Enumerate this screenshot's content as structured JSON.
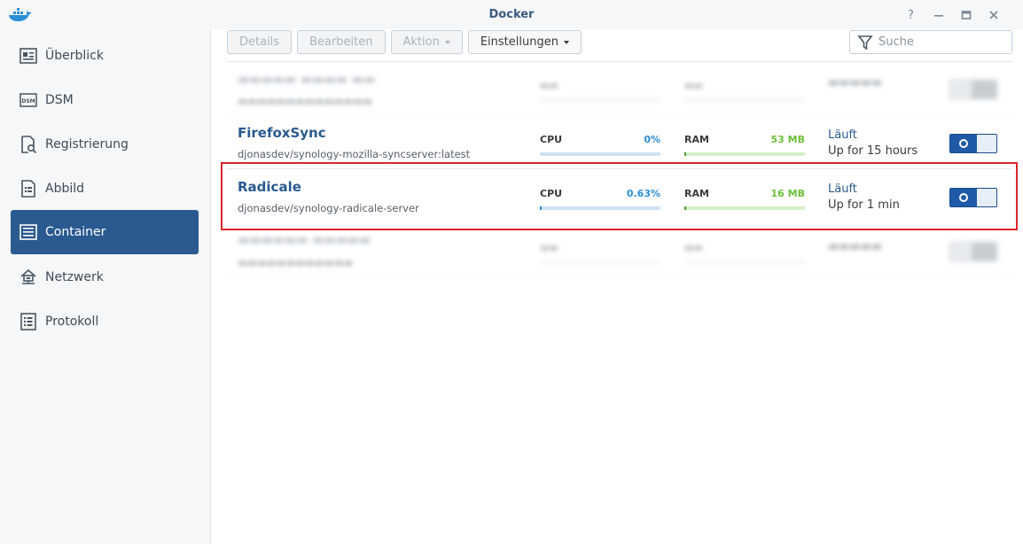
{
  "window": {
    "title": "Docker",
    "controls": [
      "help",
      "minimize",
      "maximize",
      "close"
    ]
  },
  "sidebar": {
    "items": [
      {
        "label": "Überblick",
        "icon": "overview-icon",
        "active": false
      },
      {
        "label": "DSM",
        "icon": "dsm-icon",
        "active": false
      },
      {
        "label": "Registrierung",
        "icon": "registry-icon",
        "active": false
      },
      {
        "label": "Abbild",
        "icon": "image-icon",
        "active": false
      },
      {
        "label": "Container",
        "icon": "container-icon",
        "active": true
      },
      {
        "label": "Netzwerk",
        "icon": "network-icon",
        "active": false
      },
      {
        "label": "Protokoll",
        "icon": "log-icon",
        "active": false
      }
    ]
  },
  "toolbar": {
    "details_label": "Details",
    "edit_label": "Bearbeiten",
    "action_label": "Aktion",
    "settings_label": "Einstellungen",
    "search_placeholder": "Suche"
  },
  "containers": [
    {
      "name": "FirefoxSync",
      "image": "djonasdev/synology-mozilla-syncserver:latest",
      "cpu_label": "CPU",
      "cpu_value": "0%",
      "cpu_fraction": 0.0,
      "ram_label": "RAM",
      "ram_value": "53 MB",
      "ram_fraction": 0.005,
      "status": "Läuft",
      "uptime": "Up for 15 hours",
      "running": true
    },
    {
      "name": "Radicale",
      "image": "djonasdev/synology-radicale-server",
      "cpu_label": "CPU",
      "cpu_value": "0.63%",
      "cpu_fraction": 0.0063,
      "ram_label": "RAM",
      "ram_value": "16 MB",
      "ram_fraction": 0.002,
      "status": "Läuft",
      "uptime": "Up for 1 min",
      "running": true
    }
  ],
  "colors": {
    "accent": "#2a5a8f",
    "cpu_value": "#2a8fd6",
    "ram_value": "#6cbf3a",
    "cpu_bar": "#cfe1f3",
    "ram_bar": "#d5efc8",
    "highlight": "#d9262b"
  }
}
